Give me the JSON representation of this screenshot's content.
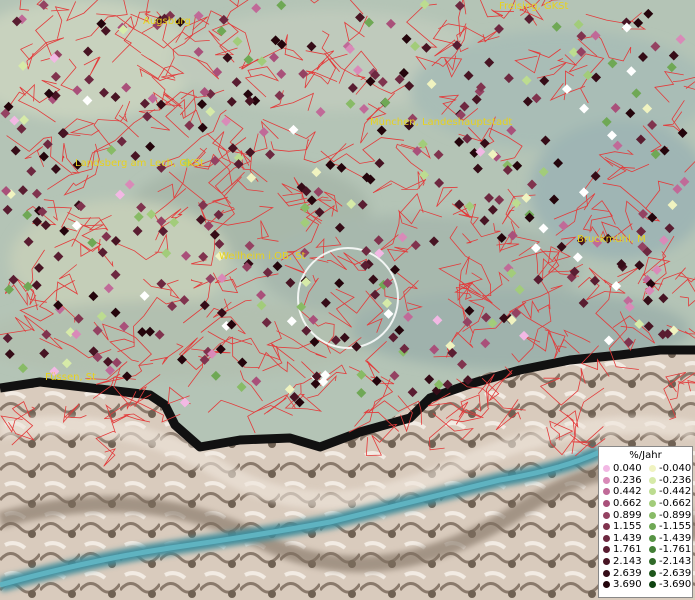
{
  "map": {
    "cities": [
      {
        "id": "augsburg",
        "name": "Augsburg"
      },
      {
        "id": "freising",
        "name": "Freising, GKSt"
      },
      {
        "id": "muenchen",
        "name": "München, Landeshauptstadt"
      },
      {
        "id": "landsberg",
        "name": "Landsberg am Lech, GKSt"
      },
      {
        "id": "weilheim",
        "name": "Weilheim i.OB, St"
      },
      {
        "id": "bruckmuehl",
        "name": "Bruckmühl, M"
      },
      {
        "id": "fuessen",
        "name": "Füssen, St"
      }
    ]
  },
  "legend": {
    "title": "%/Jahr",
    "positive": [
      "0.040",
      "0.236",
      "0.442",
      "0.662",
      "0.899",
      "1.155",
      "1.439",
      "1.761",
      "2.143",
      "2.639",
      "3.690"
    ],
    "negative": [
      "-0.040",
      "-0.236",
      "-0.442",
      "-0.662",
      "-0.899",
      "-1.155",
      "-1.439",
      "-1.761",
      "-2.143",
      "-2.639",
      "-3.690"
    ],
    "positive_colors": [
      "#f2b8e4",
      "#d98ab8",
      "#c06a98",
      "#a9507a",
      "#944262",
      "#80334e",
      "#6d2840",
      "#591d31",
      "#471423",
      "#350c17",
      "#24050c"
    ],
    "negative_colors": [
      "#f0f3c0",
      "#d6eaa8",
      "#bcdc90",
      "#a2cc7a",
      "#88bb66",
      "#6fa855",
      "#579444",
      "#437f36",
      "#306a28",
      "#1e561b",
      "#0e4210"
    ]
  }
}
